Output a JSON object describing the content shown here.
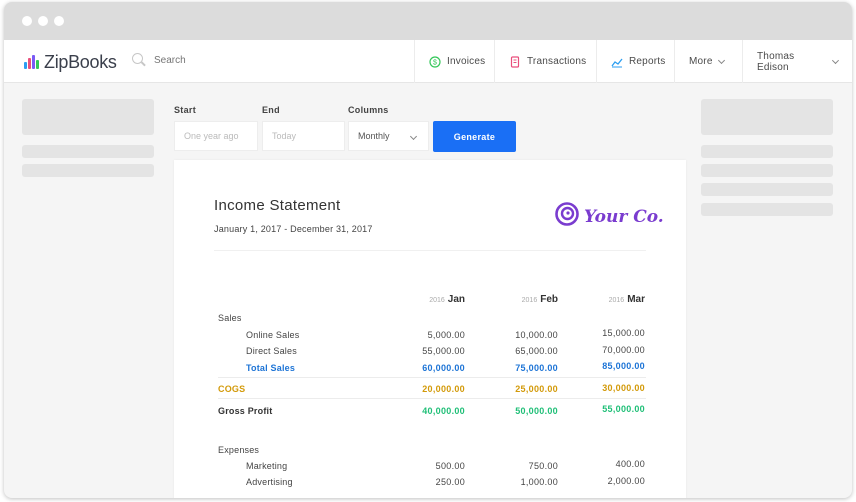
{
  "app": {
    "logo_text": "ZipBooks",
    "logo_colors": [
      "#2b9ef1",
      "#e94f7c",
      "#7a5af5",
      "#34c759"
    ]
  },
  "search": {
    "placeholder": "Search"
  },
  "nav": {
    "items": [
      {
        "label": "Invoices",
        "icon": "dollar-circle-icon"
      },
      {
        "label": "Transactions",
        "icon": "receipt-icon"
      },
      {
        "label": "Reports",
        "icon": "chart-icon"
      },
      {
        "label": "More",
        "icon": "chevron-down-icon"
      }
    ],
    "user_name": "Thomas Edison"
  },
  "controls": {
    "start_label": "Start",
    "start_placeholder": "One year ago",
    "end_label": "End",
    "end_placeholder": "Today",
    "columns_label": "Columns",
    "columns_value": "Monthly",
    "generate_label": "Generate"
  },
  "report": {
    "title": "Income Statement",
    "date_range": "January 1, 2017 - December 31, 2017",
    "company_logo_text": "Your Co.",
    "columns": [
      {
        "year": "2016",
        "month": "Jan"
      },
      {
        "year": "2016",
        "month": "Feb"
      },
      {
        "year": "2016",
        "month": "Mar"
      }
    ],
    "sales_label": "Sales",
    "online_sales": {
      "label": "Online Sales",
      "values": [
        "5,000.00",
        "10,000.00",
        "15,000.00"
      ]
    },
    "direct_sales": {
      "label": "Direct Sales",
      "values": [
        "55,000.00",
        "65,000.00",
        "70,000.00"
      ]
    },
    "total_sales": {
      "label": "Total Sales",
      "values": [
        "60,000.00",
        "75,000.00",
        "85,000.00"
      ]
    },
    "cogs": {
      "label": "COGS",
      "values": [
        "20,000.00",
        "25,000.00",
        "30,000.00"
      ]
    },
    "gross_profit": {
      "label": "Gross Profit",
      "values": [
        "40,000.00",
        "50,000.00",
        "55,000.00"
      ]
    },
    "expenses_label": "Expenses",
    "marketing": {
      "label": "Marketing",
      "values": [
        "500.00",
        "750.00",
        "400.00"
      ]
    },
    "advertising": {
      "label": "Advertising",
      "values": [
        "250.00",
        "1,000.00",
        "2,000.00"
      ]
    }
  },
  "colors": {
    "accent_blue": "#1a6ff5",
    "total_blue": "#1d74d6",
    "cogs_orange": "#d39a0a",
    "profit_green": "#1fbf77",
    "brand_purple": "#7a3ccf"
  }
}
